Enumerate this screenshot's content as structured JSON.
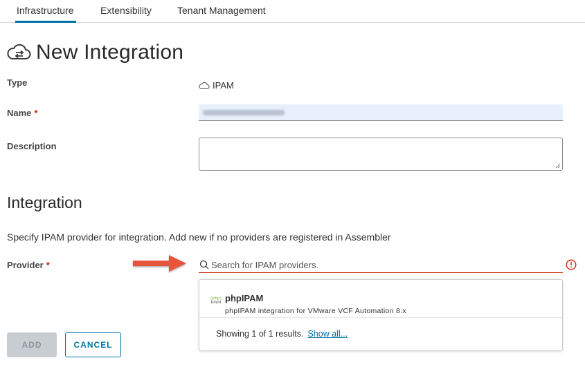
{
  "tabs": [
    {
      "label": "Infrastructure",
      "active": true
    },
    {
      "label": "Extensibility",
      "active": false
    },
    {
      "label": "Tenant Management",
      "active": false
    }
  ],
  "page": {
    "title": "New Integration",
    "title_icon": "cloud-transfer-icon"
  },
  "form": {
    "type_label": "Type",
    "type_value": "IPAM",
    "type_icon": "cloud-icon",
    "name_label": "Name",
    "required_mark": "*",
    "description_label": "Description",
    "description_value": ""
  },
  "integration": {
    "section_title": "Integration",
    "info_text": "Specify IPAM provider for integration. Add new if no providers are registered in Assembler",
    "provider_label": "Provider",
    "search_placeholder": "Search for IPAM providers.",
    "search_value": ""
  },
  "dropdown": {
    "items": [
      {
        "logo_top": "{php}",
        "logo_bottom": "IPAM",
        "name": "phpIPAM",
        "description": "phpIPAM integration for VMware VCF Automation 8.x"
      }
    ],
    "results_text": "Showing 1 of 1 results.",
    "show_all_label": "Show all..."
  },
  "actions": {
    "add_label": "ADD",
    "cancel_label": "CANCEL"
  },
  "colors": {
    "accent": "#0072a3",
    "error": "#c92100",
    "arrow": "#e8553e",
    "disabled_bg": "#c8cdd1",
    "name_field_bg": "#e8f0fb"
  }
}
